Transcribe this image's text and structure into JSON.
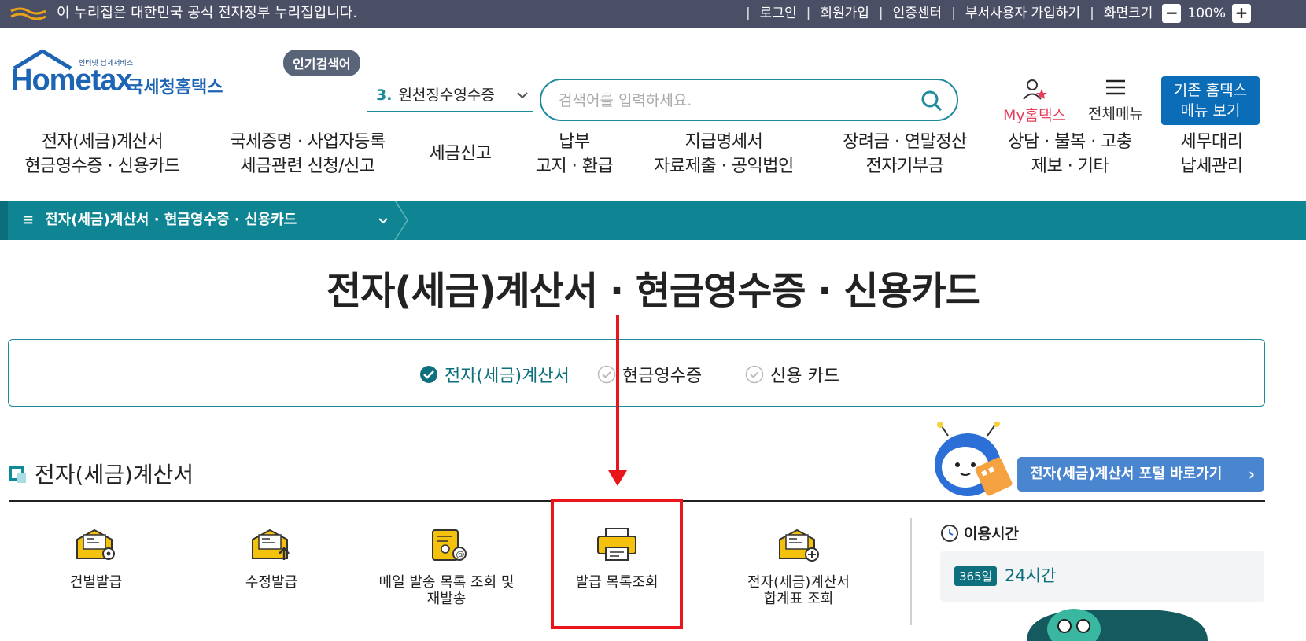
{
  "topbar": {
    "notice": "이 누리집은 대한민국 공식 전자정부 누리집입니다.",
    "links": [
      "로그인",
      "회원가입",
      "인증센터",
      "부서사용자 가입하기",
      "화면크기"
    ],
    "zoom": "100%",
    "zoom_minus": "−",
    "zoom_plus": "+"
  },
  "header": {
    "logo_tagline": "인터넷 납세서비스",
    "logo_text": "Hometax",
    "logo_kr": "국세청홈택스",
    "popular_badge": "인기검색어",
    "popular_num": "3.",
    "popular_keyword": "원천징수영수증",
    "search_placeholder": "검색어를 입력하세요.",
    "my_hometax": "My홈택스",
    "all_menu": "전체메뉴",
    "legacy_line1": "기존 홈택스",
    "legacy_line2": "메뉴 보기"
  },
  "gnb": [
    {
      "line1": "전자(세금)계산서",
      "line2": "현금영수증 · 신용카드"
    },
    {
      "line1": "국세증명 · 사업자등록",
      "line2": "세금관련 신청/신고"
    },
    {
      "line1": "세금신고",
      "line2": ""
    },
    {
      "line1": "납부",
      "line2": "고지 · 환급"
    },
    {
      "line1": "지급명세서",
      "line2": "자료제출 · 공익법인"
    },
    {
      "line1": "장려금 · 연말정산",
      "line2": "전자기부금"
    },
    {
      "line1": "상담 · 불복 · 고충",
      "line2": "제보 · 기타"
    },
    {
      "line1": "세무대리",
      "line2": "납세관리"
    }
  ],
  "breadcrumb": {
    "label": "전자(세금)계산서 · 현금영수증 · 신용카드"
  },
  "page_title": "전자(세금)계산서 · 현금영수증 · 신용카드",
  "tabs": [
    {
      "label": "전자(세금)계산서",
      "active": true
    },
    {
      "label": "현금영수증",
      "active": false
    },
    {
      "label": "신용 카드",
      "active": false
    }
  ],
  "section": {
    "title": "전자(세금)계산서",
    "portal_button": "전자(세금)계산서 포털 바로가기",
    "portal_arrow": "›"
  },
  "services": [
    {
      "line1": "건별발급",
      "line2": "",
      "icon": "envelope-gear-icon"
    },
    {
      "line1": "수정발급",
      "line2": "",
      "icon": "envelope-up-icon"
    },
    {
      "line1": "메일 발송 목록 조회 및",
      "line2": "재발송",
      "icon": "scroll-at-icon"
    },
    {
      "line1": "발급 목록조회",
      "line2": "",
      "icon": "printer-icon"
    },
    {
      "line1": "전자(세금)계산서",
      "line2": "합계표 조회",
      "icon": "envelope-plus-icon"
    }
  ],
  "usage": {
    "title": "이용시간",
    "badge": "365일",
    "hours": "24시간"
  },
  "colors": {
    "teal": "#0f8593",
    "topbar": "#4b4f66",
    "blue_button": "#0b6db7",
    "highlight": "#e8161a"
  }
}
